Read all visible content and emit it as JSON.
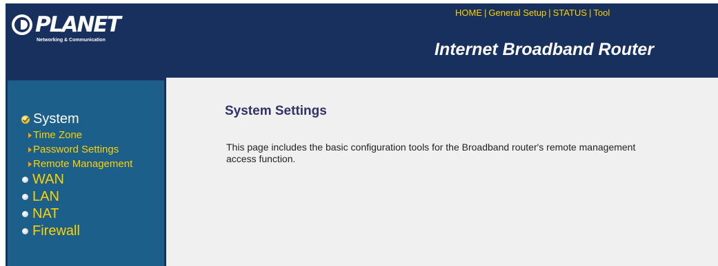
{
  "brand": {
    "logo_text": "PLANET",
    "tagline": "Networking & Communication"
  },
  "top_nav": [
    "HOME",
    "General Setup",
    "STATUS",
    "Tool"
  ],
  "header_title": "Internet Broadband Router",
  "sidebar": {
    "active_section": "System",
    "sub_items": [
      "Time Zone",
      "Password Settings",
      "Remote Management"
    ],
    "sections": [
      "WAN",
      "LAN",
      "NAT",
      "Firewall"
    ]
  },
  "main": {
    "title": "System Settings",
    "description": "This page includes the basic configuration tools for the Broadband router's remote management access function."
  },
  "colors": {
    "header_bg": "#17305d",
    "sidebar_bg": "#1b5f8a",
    "link_yellow": "#ffd200",
    "content_bg": "#f0f0f0",
    "title_color": "#313265"
  },
  "icons": {
    "active_section": "check-icon",
    "section": "bullet-icon",
    "sub_item": "arrow-right-icon"
  }
}
